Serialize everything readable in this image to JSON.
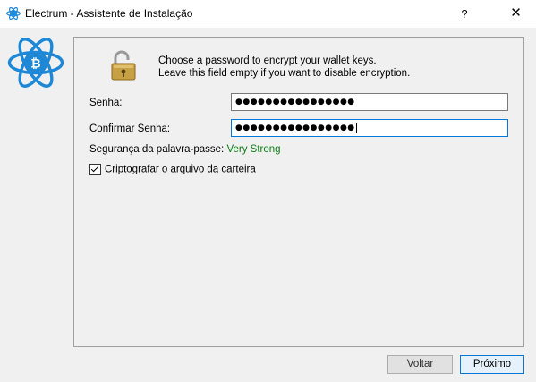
{
  "window": {
    "title": "Electrum  -  Assistente de Instalação",
    "help_glyph": "?",
    "close_glyph": "✕"
  },
  "panel": {
    "instruction_line1": "Choose a password to encrypt your wallet keys.",
    "instruction_line2": "Leave this field empty if you want to disable encryption.",
    "password_label": "Senha:",
    "password_value": "●●●●●●●●●●●●●●●●",
    "confirm_label": "Confirmar Senha:",
    "confirm_value": "●●●●●●●●●●●●●●●●",
    "strength_label": "Segurança da palavra-passe:",
    "strength_value": "Very Strong",
    "encrypt_file_label": "Criptografar o arquivo da carteira",
    "encrypt_file_checked": true
  },
  "buttons": {
    "back": "Voltar",
    "next": "Próximo"
  },
  "icons": {
    "app": "electrum-icon",
    "logo": "electrum-logo",
    "lock": "lock-icon"
  },
  "colors": {
    "logo_blue": "#1e88d7",
    "strength_green": "#0d7d15",
    "focus_border": "#0078d7",
    "lock_gold": "#c8a044"
  }
}
